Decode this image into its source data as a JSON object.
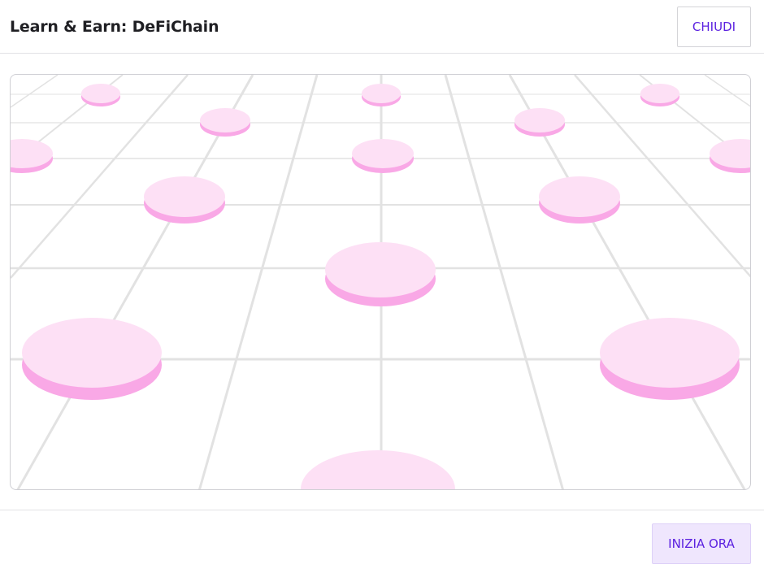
{
  "dialog": {
    "title": "Learn & Earn: DeFiChain",
    "close_label": "CHIUDI",
    "start_label": "INIZIA ORA"
  },
  "colors": {
    "accent": "#5b21e0",
    "start_button_bg": "#efe6fd",
    "coin_top": "#fde0f5",
    "coin_side": "#f9a8e6",
    "grid_line": "#e2e2e2"
  },
  "illustration": {
    "icon": "pink-coins-on-grid-icon"
  }
}
